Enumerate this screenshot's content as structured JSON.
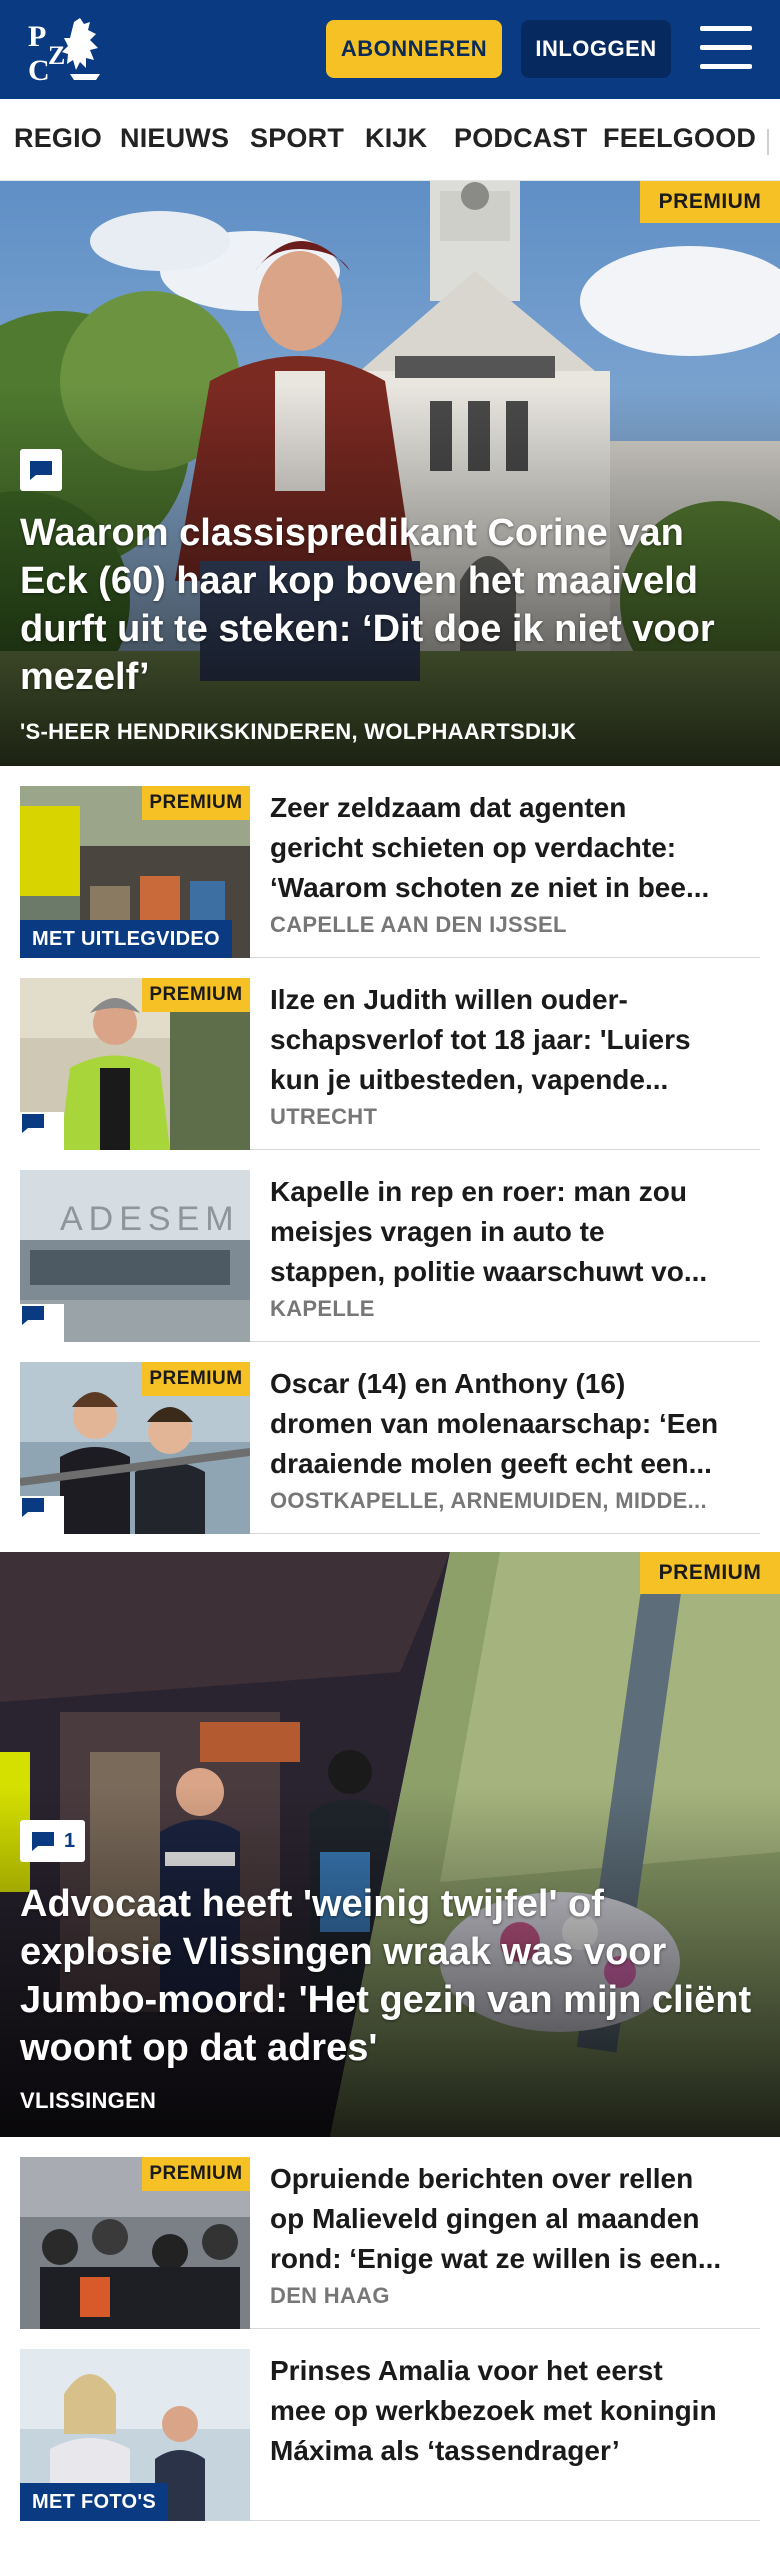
{
  "header": {
    "logo_text": "PZC",
    "subscribe_label": "ABONNEREN",
    "login_label": "INLOGGEN",
    "brand_color": "#0a3a82",
    "accent_color": "#f5c125"
  },
  "nav": {
    "items": [
      "REGIO",
      "NIEUWS",
      "SPORT",
      "KIJK",
      "PODCAST",
      "FEELGOOD"
    ]
  },
  "hero1": {
    "premium": "PREMIUM",
    "title": "Waarom classispredikant Corine van Eck (60) haar kop boven het maaiveld durft uit te steken: ‘Dit doe ik niet voor mezelf’",
    "location": "'S-HEER HENDRIKSKINDEREN, WOLPHAARTSDIJK",
    "icon": "comment-icon"
  },
  "articles": [
    {
      "premium": "PREMIUM",
      "media_tag": "MET UITLEGVIDEO",
      "title_lines": [
        "Zeer zeldzaam dat agenten",
        "gericht schieten op verdachte:",
        "‘Waarom schoten ze niet in bee..."
      ],
      "location": "CAPELLE AAN DEN IJSSEL"
    },
    {
      "premium": "PREMIUM",
      "title_lines": [
        "Ilze en Judith willen ouder-",
        "schapsverlof tot 18 jaar: 'Luiers",
        "kun je uitbesteden, vapende..."
      ],
      "location": "UTRECHT"
    },
    {
      "title_lines": [
        "Kapelle in rep en roer: man zou",
        "meisjes vragen in auto te",
        "stappen, politie waarschuwt vo..."
      ],
      "location": "KAPELLE"
    },
    {
      "premium": "PREMIUM",
      "title_lines": [
        "Oscar (14) en Anthony (16)",
        "dromen van molenaarschap: ‘Een",
        "draaiende molen geeft echt een..."
      ],
      "location": "OOSTKAPELLE, ARNEMUIDEN, MIDDE..."
    }
  ],
  "hero2": {
    "premium": "PREMIUM",
    "comment_count": "1",
    "title": "Advocaat heeft 'weinig twijfel' of explosie Vlissingen wraak was voor Jumbo-moord: 'Het gezin van mijn cliënt woont op dat adres'",
    "location": "VLISSINGEN"
  },
  "articles2": [
    {
      "premium": "PREMIUM",
      "title_lines": [
        "Opruiende berichten over rellen",
        "op Malieveld gingen al maanden",
        "rond: ‘Enige wat ze willen is een..."
      ],
      "location": "DEN HAAG"
    },
    {
      "media_tag": "MET FOTO'S",
      "title_lines": [
        "Prinses Amalia voor het eerst",
        "mee op werkbezoek met koningin",
        "Máxima als ‘tassendrager’"
      ],
      "location": ""
    }
  ]
}
